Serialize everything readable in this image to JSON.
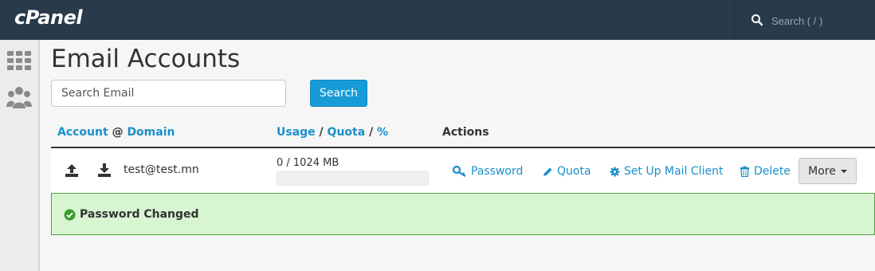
{
  "topbar": {
    "logo": "cPanel",
    "search_placeholder": "Search ( / )",
    "search_icon": "search-icon"
  },
  "sidebar": {
    "items": [
      {
        "icon": "grid-icon"
      },
      {
        "icon": "users-icon"
      }
    ]
  },
  "page": {
    "title": "Email Accounts",
    "search": {
      "placeholder": "Search Email",
      "button_label": "Search"
    }
  },
  "table": {
    "headers": {
      "account": "Account",
      "at": "@",
      "domain": "Domain",
      "usage": "Usage",
      "slash1": "/",
      "quota": "Quota",
      "slash2": "/",
      "percent": "%",
      "actions": "Actions"
    },
    "rows": [
      {
        "email": "test@test.mn",
        "usage_text": "0 / 1024 MB",
        "usage_fraction": 0,
        "upload_icon": "upload-icon",
        "download_icon": "download-icon",
        "actions": {
          "password": "Password",
          "quota": "Quota",
          "setup": "Set Up Mail Client",
          "delete": "Delete",
          "more": "More"
        }
      }
    ]
  },
  "alert": {
    "message": "Password Changed",
    "icon": "check-circle-icon",
    "color": "#52a044"
  },
  "colors": {
    "accent": "#179bd7",
    "link": "#1a8fc9",
    "topbar": "#293a4a"
  }
}
